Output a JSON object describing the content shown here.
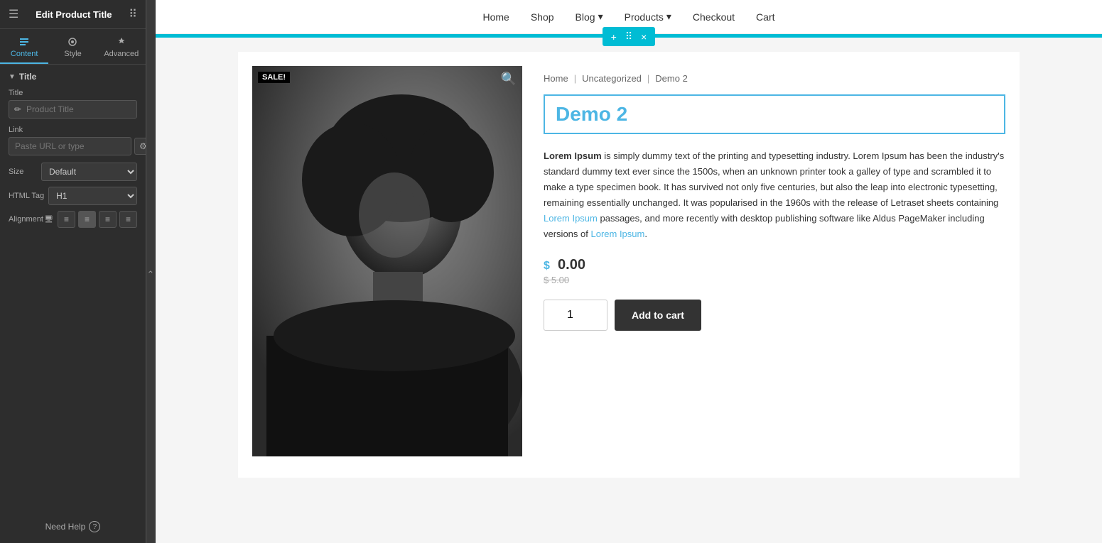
{
  "sidebar": {
    "header_title": "Edit Product Title",
    "tabs": [
      {
        "id": "content",
        "label": "Content",
        "active": true
      },
      {
        "id": "style",
        "label": "Style",
        "active": false
      },
      {
        "id": "advanced",
        "label": "Advanced",
        "active": false
      }
    ],
    "section_title": "Title",
    "fields": {
      "title_label": "Title",
      "title_placeholder": "Product Title",
      "link_label": "Link",
      "link_placeholder": "Paste URL or type",
      "size_label": "Size",
      "size_default": "Default",
      "html_tag_label": "HTML Tag",
      "html_tag_default": "H1",
      "alignment_label": "Alignment"
    },
    "need_help": "Need Help"
  },
  "nav": {
    "items": [
      {
        "id": "home",
        "label": "Home"
      },
      {
        "id": "shop",
        "label": "Shop"
      },
      {
        "id": "blog",
        "label": "Blog",
        "has_dropdown": true
      },
      {
        "id": "products",
        "label": "Products",
        "has_dropdown": true
      },
      {
        "id": "checkout",
        "label": "Checkout"
      },
      {
        "id": "cart",
        "label": "Cart"
      }
    ]
  },
  "cyan_toolbar": {
    "plus_label": "+",
    "grid_label": "⠿",
    "close_label": "×"
  },
  "product": {
    "sale_badge": "SALE!",
    "breadcrumb": {
      "home": "Home",
      "category": "Uncategorized",
      "current": "Demo 2"
    },
    "title": "Demo 2",
    "description": "Lorem Ipsum is simply dummy text of the printing and typesetting industry. Lorem Ipsum has been the industry's standard dummy text ever since the 1500s, when an unknown printer took a galley of type and scrambled it to make a type specimen book. It has survived not only five centuries, but also the leap into electronic typesetting, remaining essentially unchanged. It was popularised in the 1960s with the release of Letraset sheets containing Lorem Ipsum passages, and more recently with desktop publishing software like Aldus PageMaker including versions of Lorem Ipsum.",
    "price_currency": "$",
    "price_current": "0.00",
    "price_original": "$ 5.00",
    "quantity_value": "1",
    "add_to_cart_label": "Add to cart"
  }
}
